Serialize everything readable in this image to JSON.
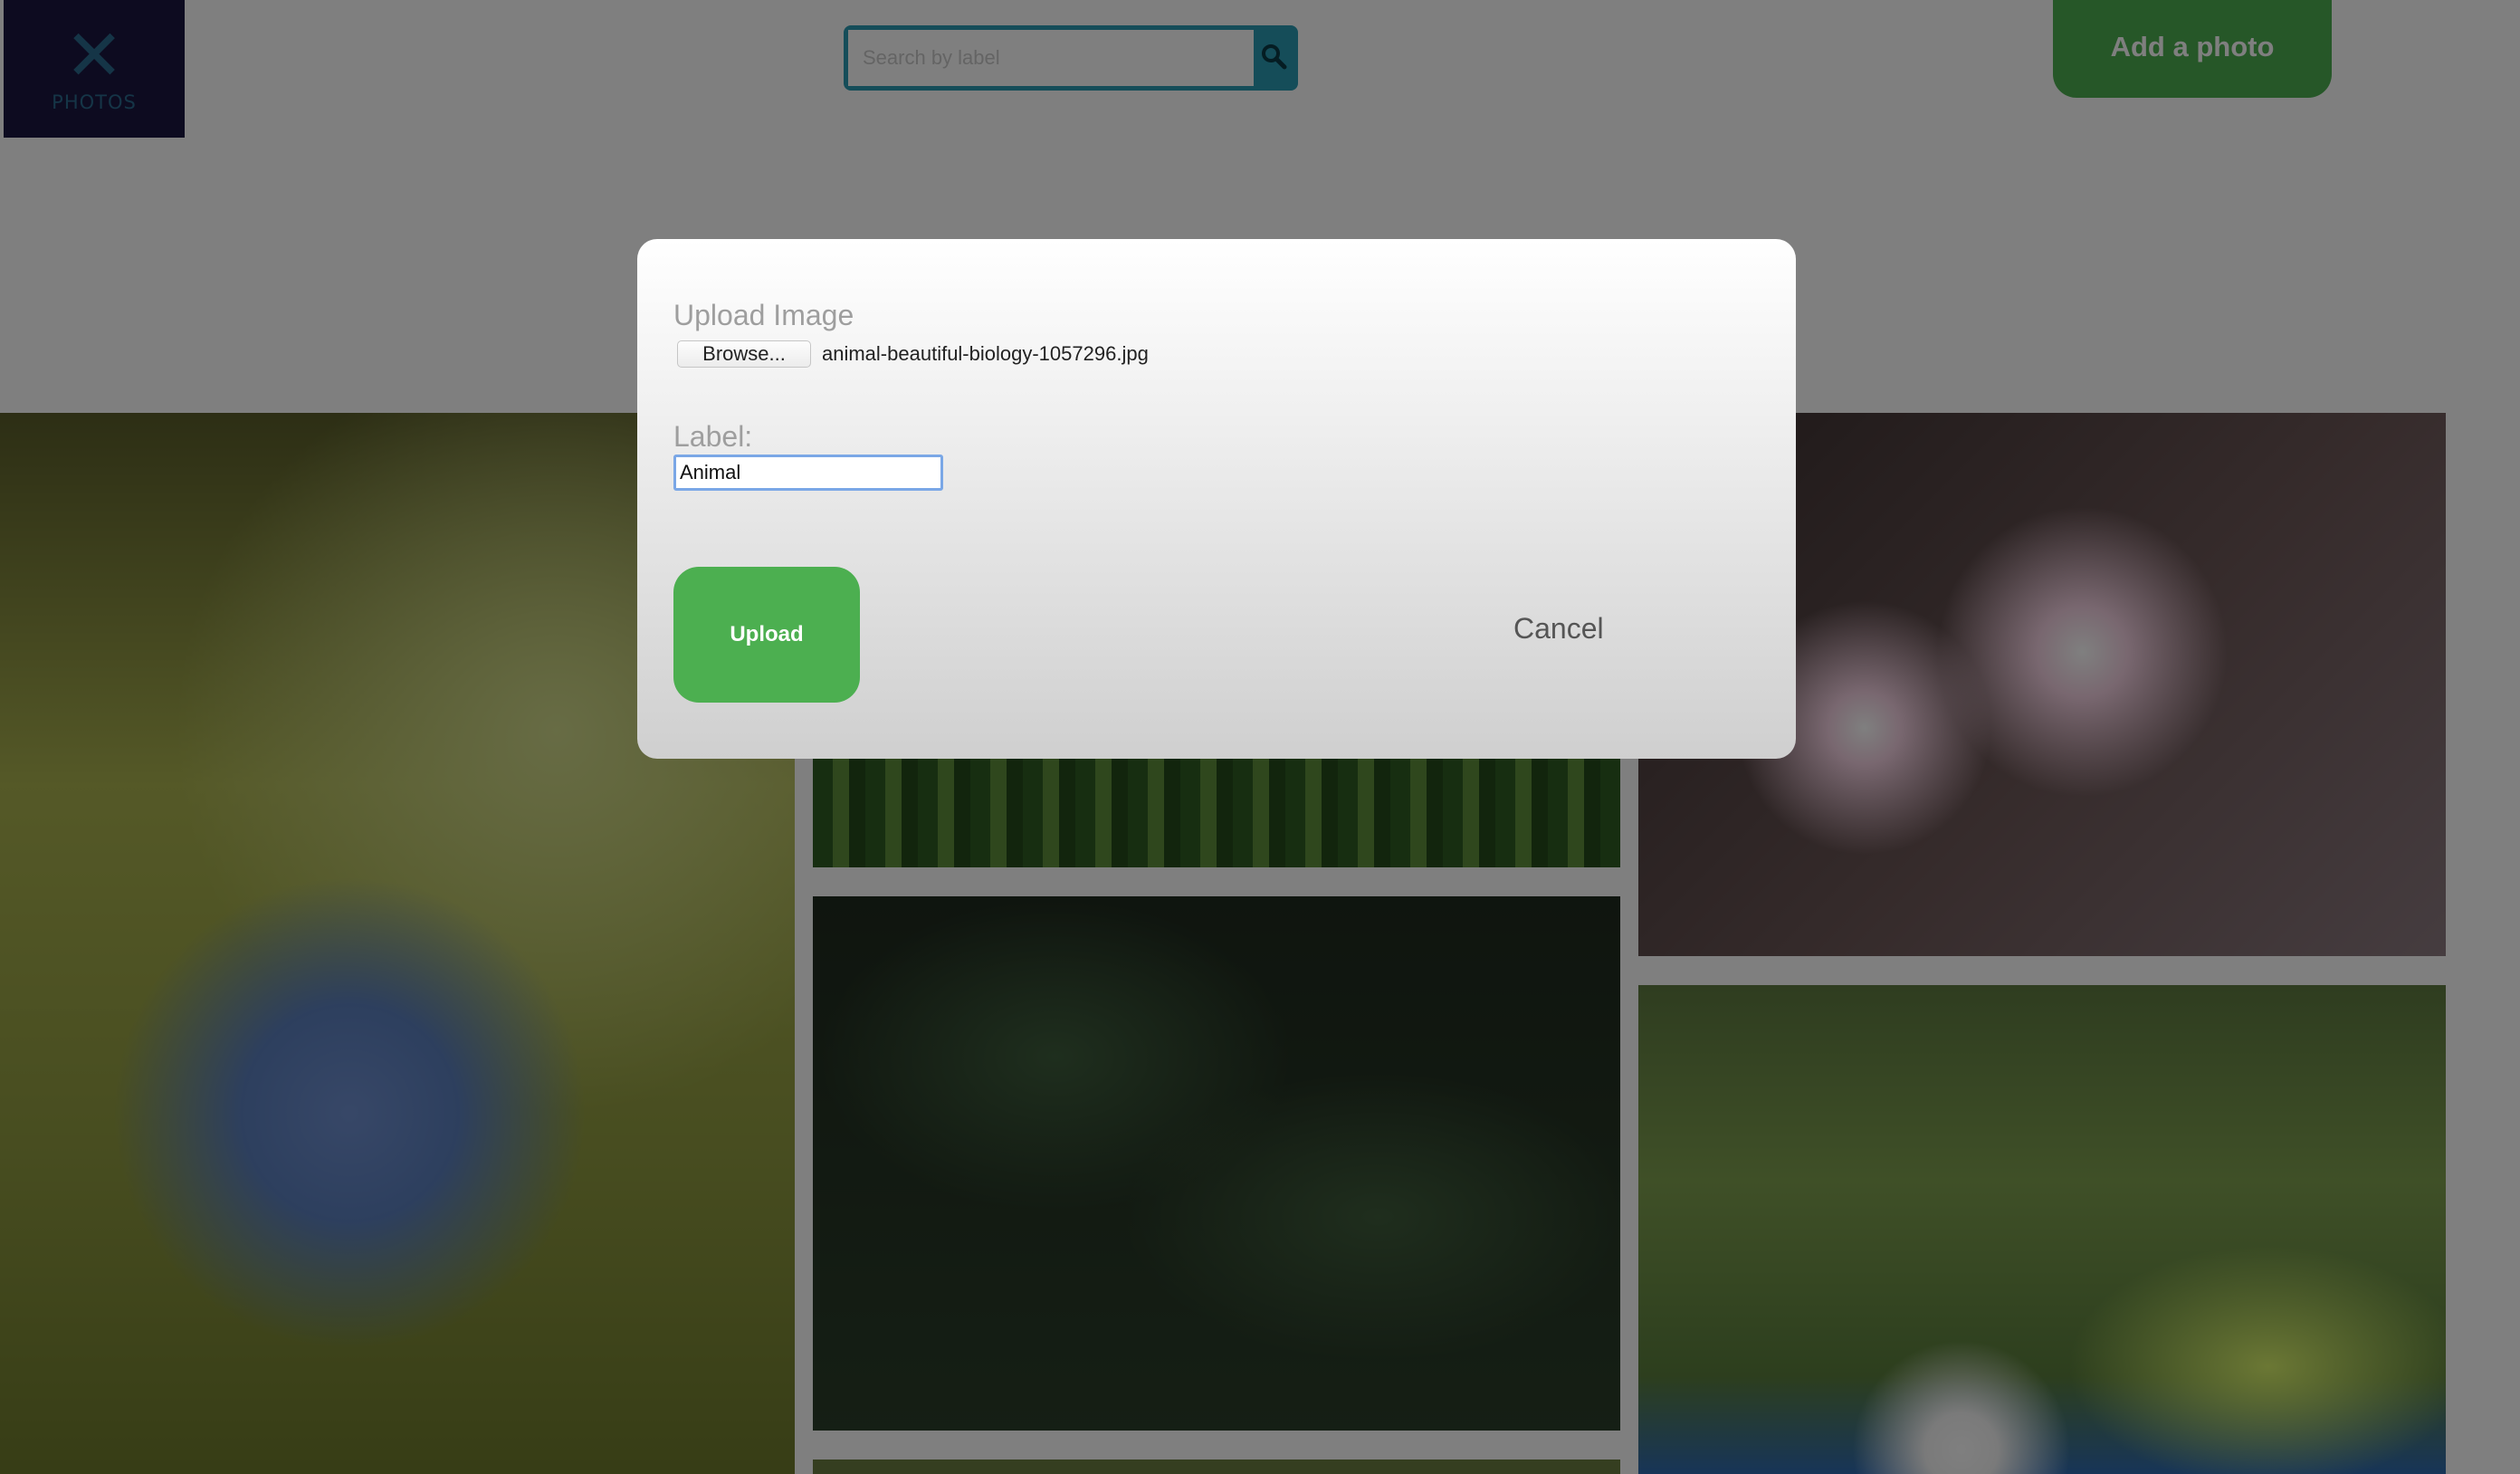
{
  "header": {
    "logo_text": "PHOTOS",
    "search_placeholder": "Search by label",
    "add_photo_label": "Add a photo"
  },
  "modal": {
    "title": "Upload Image",
    "browse_label": "Browse...",
    "file_name": "animal-beautiful-biology-1057296.jpg",
    "label_title": "Label:",
    "label_value": "Animal",
    "upload_label": "Upload",
    "cancel_label": "Cancel"
  },
  "colors": {
    "accent": "#4caf50",
    "search_border": "#2a9bb3",
    "logo_bg": "#1a1740"
  }
}
